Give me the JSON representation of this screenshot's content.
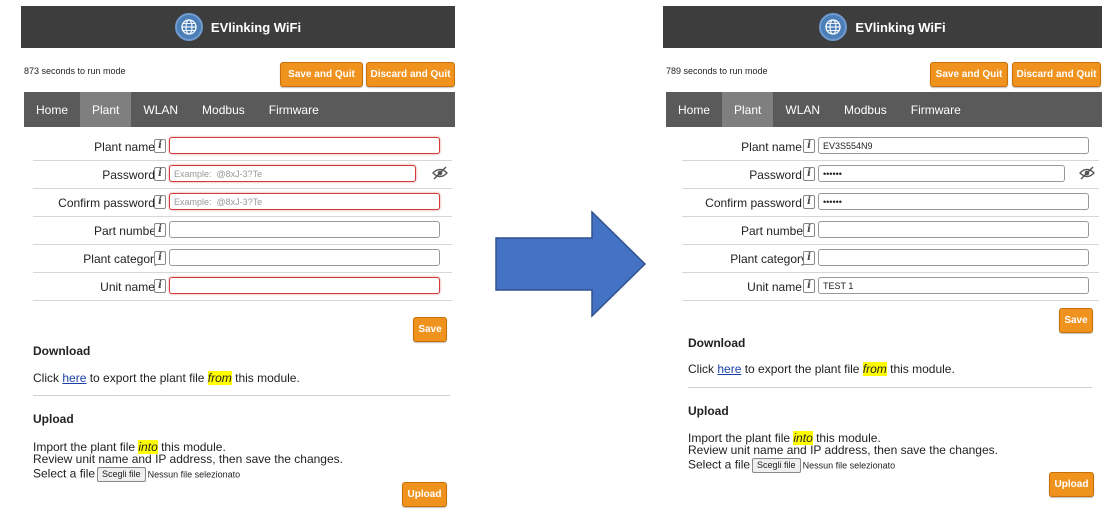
{
  "brand": "EVlinking WiFi",
  "colors": {
    "accent": "#f0921e",
    "header": "#3d3d3d",
    "nav": "#5a5a5a",
    "arrow": "#4472c4"
  },
  "nav_tabs": [
    "Home",
    "Plant",
    "WLAN",
    "Modbus",
    "Firmware"
  ],
  "buttons": {
    "save_and_quit": "Save and Quit",
    "discard_and_quit": "Discard and Quit",
    "save": "Save",
    "upload": "Upload",
    "choose_file": "Scegli file"
  },
  "form_labels": {
    "plant_name": "Plant name",
    "password": "Password",
    "confirm_password": "Confirm password",
    "part_number": "Part number",
    "plant_category": "Plant category",
    "unit_name": "Unit name"
  },
  "required_mark": "*",
  "info_glyph": "i",
  "password_placeholder": "Example:  @8xJ-3?Te",
  "download": {
    "title": "Download",
    "text_before": "Click ",
    "link": "here",
    "text_middle": " to export the plant file ",
    "highlight": "from",
    "text_after": " this module."
  },
  "upload": {
    "title": "Upload",
    "line1_before": "Import the plant file ",
    "line1_highlight": "into",
    "line1_after": " this module.",
    "line2": "Review unit name and IP address, then save the changes.",
    "select_label": "Select a file",
    "no_file": "Nessun file selezionato"
  },
  "left_panel": {
    "timer": "873 seconds to run mode",
    "values": {
      "plant_name": "",
      "password": "",
      "confirm_password": "",
      "part_number": "",
      "plant_category": "",
      "unit_name": ""
    }
  },
  "right_panel": {
    "timer": "789 seconds to run mode",
    "values": {
      "plant_name": "EV3S554N9",
      "password": "••••••",
      "confirm_password": "••••••",
      "part_number": "",
      "plant_category": "",
      "unit_name": "TEST 1"
    }
  }
}
